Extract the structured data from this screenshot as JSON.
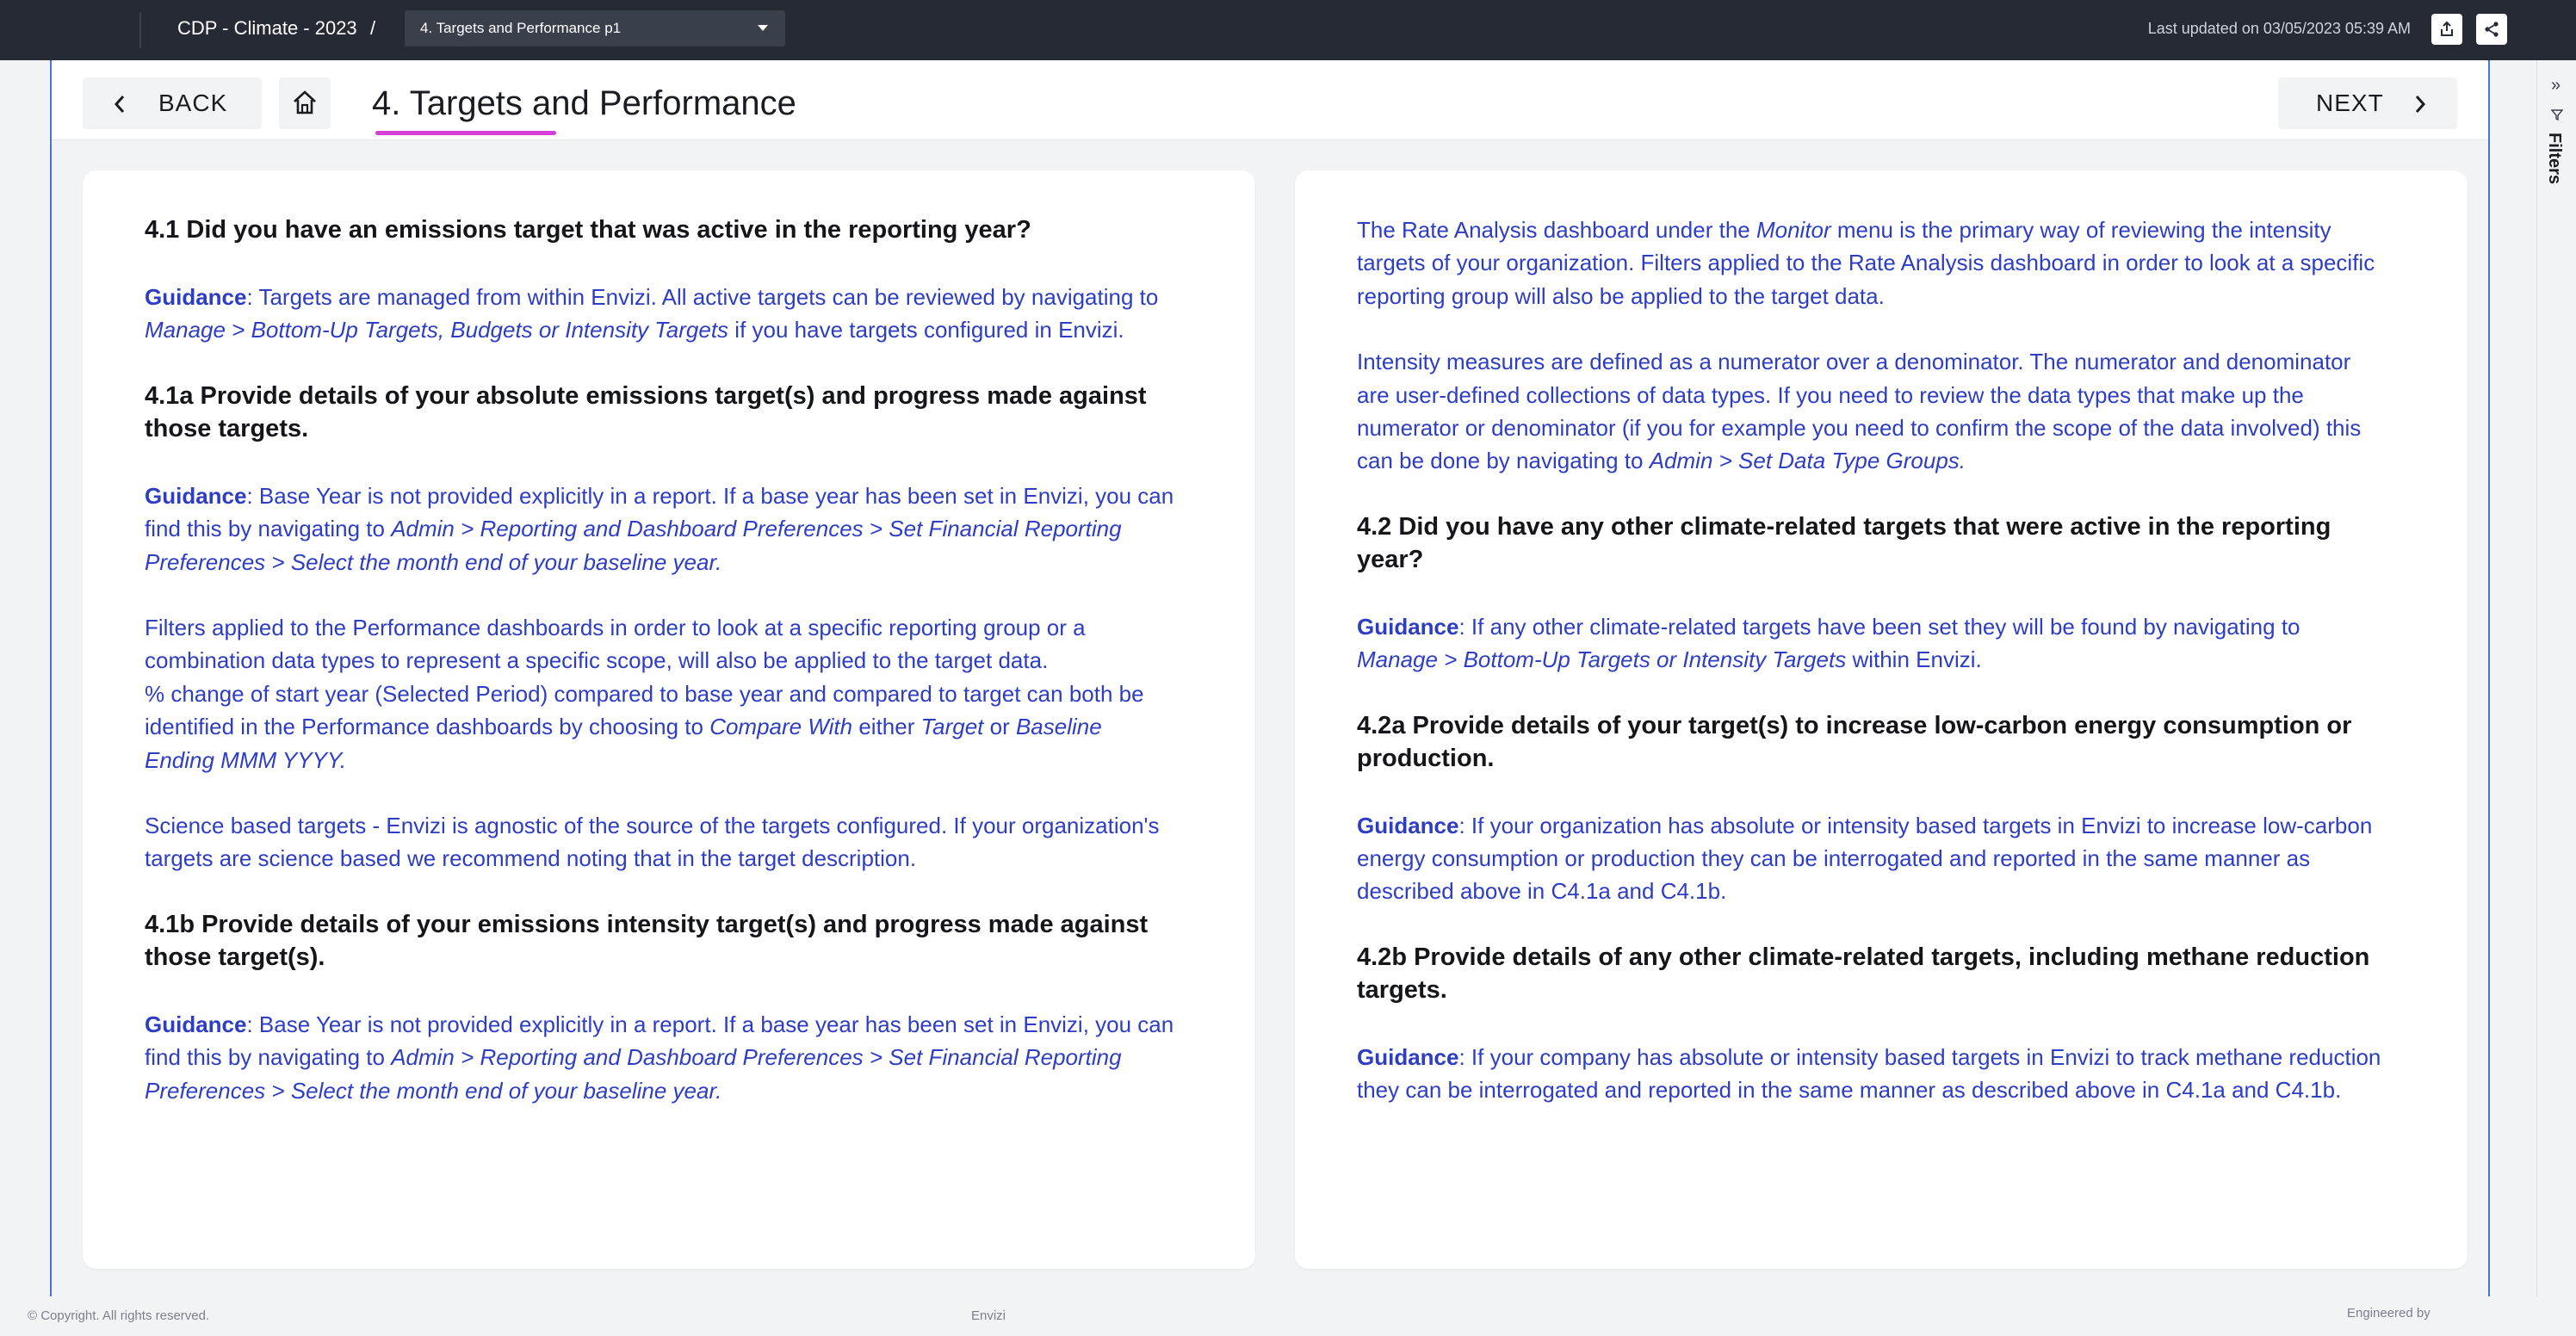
{
  "topbar": {
    "breadcrumb_title": "CDP - Climate - 2023",
    "breadcrumb_separator": "/",
    "page_select_value": "4. Targets and Performance p1",
    "last_updated": "Last updated on 03/05/2023 05:39 AM",
    "export_icon": "export-icon",
    "share_icon": "share-icon"
  },
  "header": {
    "back_label": "BACK",
    "home_icon": "home-icon",
    "title": "4. Targets and Performance",
    "next_label": "NEXT",
    "accent_color": "#d63fd6"
  },
  "left_panel": {
    "q41": "4.1 Did you have an emissions target that was active in the reporting year?",
    "g41_label": "Guidance",
    "g41_text": ": Targets are managed from within Envizi. All active targets can be reviewed by navigating to ",
    "g41_nav": "Manage > Bottom-Up Targets, Budgets or Intensity Targets",
    "g41_tail": " if you have targets configured in Envizi.",
    "q41a": "4.1a Provide details of your absolute emissions target(s) and progress made against those targets.",
    "g41a_label": "Guidance",
    "g41a_text": ": Base Year is not provided explicitly in a report. If a base year has been set in Envizi, you can find this by navigating to ",
    "g41a_nav": "Admin > Reporting and Dashboard Preferences > Set Financial Reporting Preferences > Select the month end of your baseline year.",
    "p_filters_1": "Filters applied to the Performance dashboards in order to look at a specific reporting group or a combination data types to represent a specific scope, will also be applied to the target data.",
    "p_filters_2": "% change of start year (Selected Period) compared to base year and compared to target can both be identified in the Performance dashboards by choosing to ",
    "p_filters_compare": "Compare With",
    "p_filters_either": " either ",
    "p_filters_target": "Target",
    "p_filters_or": " or ",
    "p_filters_baseline": "Baseline Ending MMM YYYY.",
    "p_science": "Science based targets - Envizi is agnostic of the source of the targets configured. If your organization's targets are science based we recommend noting that in the target description.",
    "q41b": "4.1b Provide details of your emissions intensity target(s) and progress made against those target(s).",
    "g41b_label": "Guidance",
    "g41b_text": ": Base Year is not provided explicitly in a report. If a base year has been set in Envizi, you can find this by navigating to ",
    "g41b_nav": "Admin > Reporting and Dashboard Preferences > Set Financial Reporting Preferences > Select the month end of your baseline year."
  },
  "right_panel": {
    "p_rate_1": "The Rate Analysis dashboard under the ",
    "p_rate_monitor": "Monitor",
    "p_rate_2": " menu is the primary way of reviewing the intensity targets of your organization. Filters applied to the Rate Analysis dashboard in order to look at a specific reporting group will also be applied to the target data.",
    "p_intensity": "Intensity measures are defined as a numerator over a denominator. The numerator and denominator are user-defined collections of data types. If you need to review the data types that make up the numerator or denominator (if you for example you need to confirm the scope of the data involved) this can be done by navigating to ",
    "p_intensity_nav": "Admin > Set Data Type Groups.",
    "q42": "4.2 Did you have any other climate-related targets that were active in the reporting year?",
    "g42_label": "Guidance",
    "g42_text": ": If any other climate-related targets have been set they will be found by navigating to ",
    "g42_nav": "Manage > Bottom-Up Targets or Intensity Targets",
    "g42_tail": " within Envizi.",
    "q42a": "4.2a Provide details of your target(s) to increase low-carbon energy consumption or production.",
    "g42a_label": "Guidance",
    "g42a_text": ": If your organization has absolute or intensity based targets in Envizi to increase low-carbon energy consumption or production they can be interrogated and reported in the same manner as described above in C4.1a and C4.1b.",
    "q42b": "4.2b Provide details of any other climate-related targets, including methane reduction targets.",
    "g42b_label": "Guidance",
    "g42b_text": ": If your company has absolute or intensity based targets in Envizi to track methane reduction they can be interrogated and reported in the same manner as described above in C4.1a and C4.1b."
  },
  "filters_rail": {
    "collapse_icon": "chevron-double-right-icon",
    "filter_icon": "filter-icon",
    "label": "Filters"
  },
  "footer": {
    "copyright": "© Copyright. All rights reserved.",
    "brand": "Envizi",
    "engineered_by": "Engineered by"
  }
}
